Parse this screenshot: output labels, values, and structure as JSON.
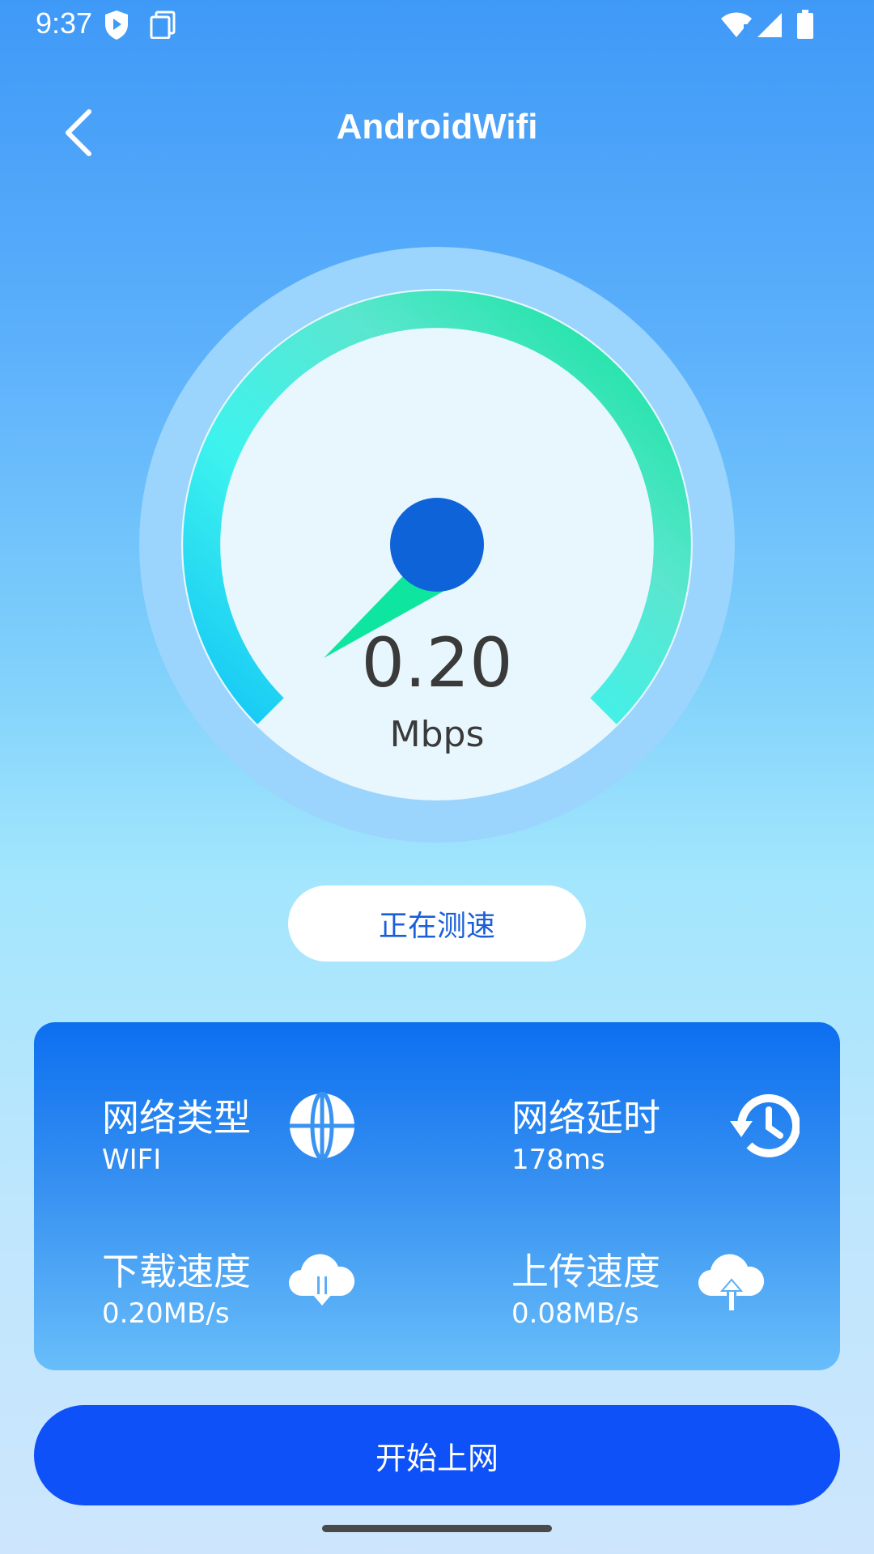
{
  "status_bar": {
    "time": "9:37",
    "left_icons": [
      "play-protect-icon",
      "screenshot-icon"
    ],
    "right_icons": [
      "wifi-icon",
      "signal-icon",
      "battery-icon"
    ]
  },
  "header": {
    "title": "AndroidWifi",
    "back_icon": "back-arrow-icon"
  },
  "gauge": {
    "value": "0.20",
    "unit": "Mbps"
  },
  "test_status": "正在测速",
  "info": {
    "network_type": {
      "label": "网络类型",
      "value": "WIFI",
      "icon": "globe-icon"
    },
    "latency": {
      "label": "网络延时",
      "value": "178ms",
      "icon": "history-clock-icon"
    },
    "download": {
      "label": "下载速度",
      "value": "0.20MB/s",
      "icon": "cloud-download-icon"
    },
    "upload": {
      "label": "上传速度",
      "value": "0.08MB/s",
      "icon": "cloud-upload-icon"
    }
  },
  "start_button": "开始上网",
  "colors": {
    "accent": "#0e51f9",
    "gauge_arc_start": "#1ac8f6",
    "gauge_arc_end": "#10e49a",
    "needle_hub": "#0f63d8"
  }
}
